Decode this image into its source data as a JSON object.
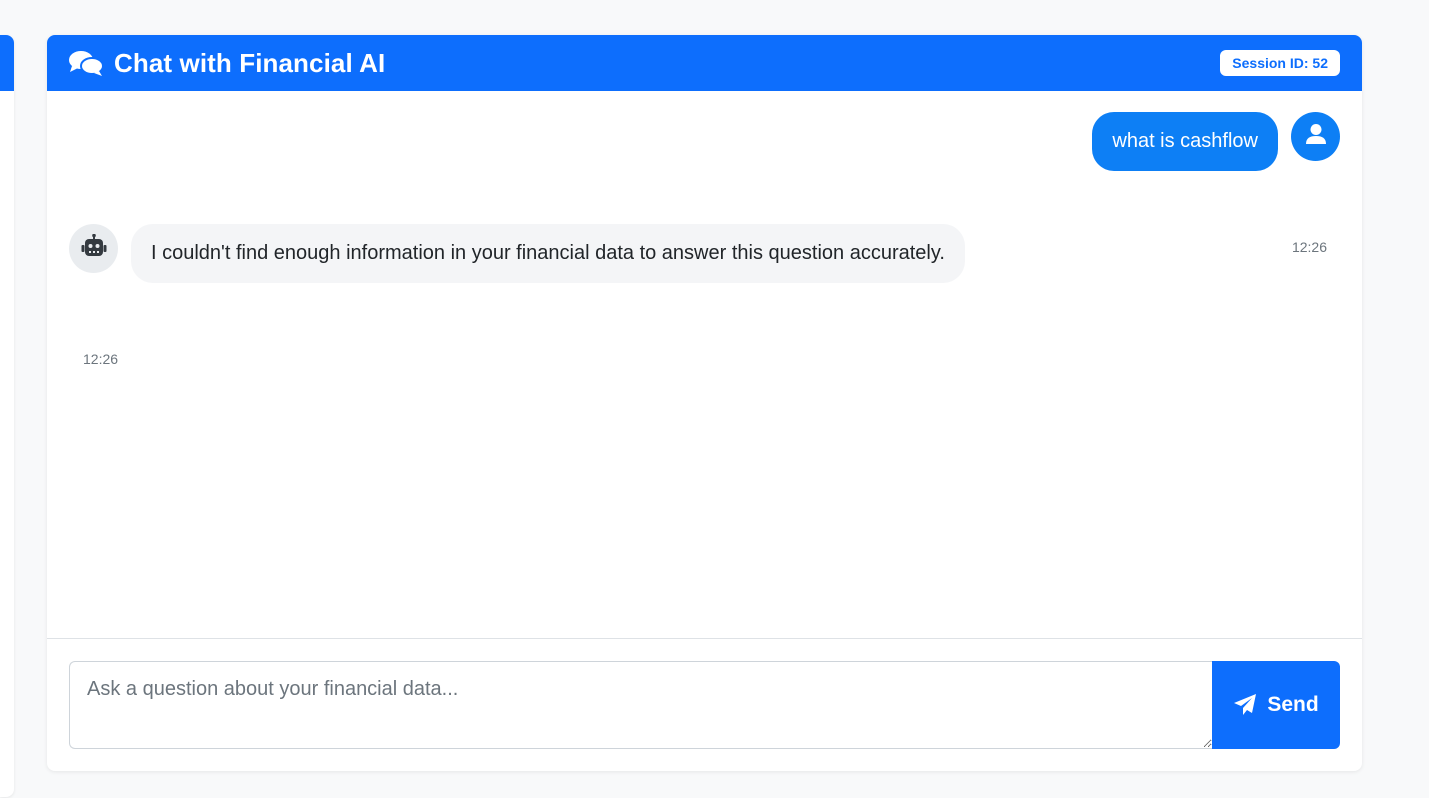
{
  "header": {
    "title": "Chat with Financial AI",
    "title_icon": "comments-icon",
    "session_badge": "Session ID: 52"
  },
  "messages": [
    {
      "role": "user",
      "text": "what is cashflow",
      "time": "12:26",
      "avatar_icon": "user-icon"
    },
    {
      "role": "assistant",
      "text": "I couldn't find enough information in your financial data to answer this question accurately.",
      "time": "12:26",
      "avatar_icon": "robot-icon"
    }
  ],
  "composer": {
    "placeholder": "Ask a question about your financial data...",
    "value": "",
    "send_label": "Send",
    "send_icon": "paper-plane-icon"
  },
  "colors": {
    "primary": "#0d6efd",
    "user_bubble": "#0d7ff5",
    "bot_bubble": "#f4f5f7",
    "page_background": "#f8f9fa"
  }
}
